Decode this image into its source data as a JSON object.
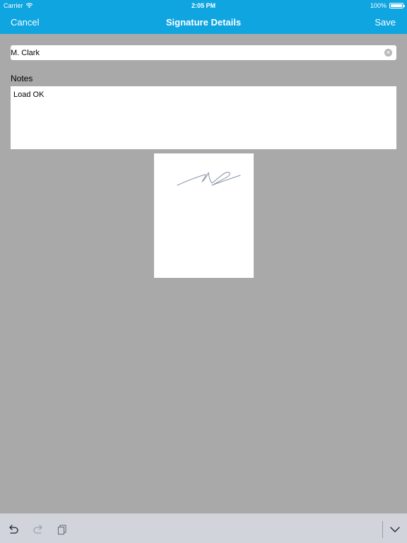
{
  "status_bar": {
    "carrier": "Carrier",
    "time": "2:05 PM",
    "battery": "100%",
    "battery_level": 1.0
  },
  "nav": {
    "cancel_label": "Cancel",
    "title": "Signature Details",
    "save_label": "Save"
  },
  "form": {
    "name_value": "M. Clark",
    "notes_label": "Notes",
    "notes_value": "Load OK"
  },
  "icons": {
    "wifi": "wifi-icon",
    "battery": "battery-icon",
    "clear": "clear-icon",
    "undo": "undo-icon",
    "redo": "redo-icon",
    "paste": "paste-icon",
    "dismiss_keyboard": "chevron-down-icon"
  },
  "colors": {
    "accent": "#0ea5e0",
    "background": "#a9a9a9",
    "toolbar": "#d1d5db",
    "signature_ink": "#8a90a8"
  }
}
